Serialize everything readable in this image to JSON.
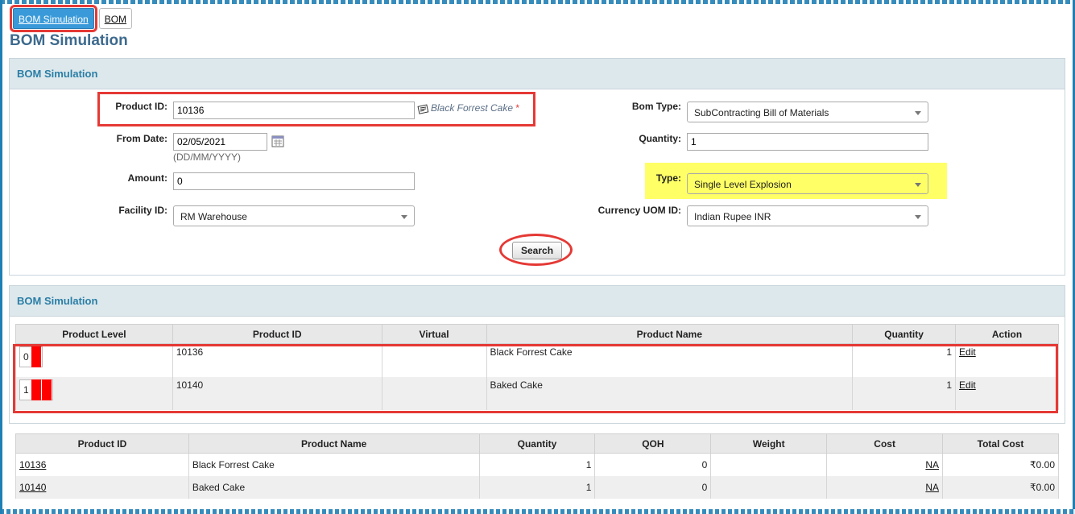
{
  "tabs": [
    {
      "label": "BOM Simulation",
      "active": true
    },
    {
      "label": "BOM",
      "active": false
    }
  ],
  "page_title": "BOM Simulation",
  "filter_panel": {
    "title": "BOM Simulation",
    "product_id": {
      "label": "Product ID:",
      "value": "10136",
      "product_name": "Black Forrest Cake",
      "required_mark": "*"
    },
    "from_date": {
      "label": "From Date:",
      "value": "02/05/2021",
      "format_hint": "(DD/MM/YYYY)"
    },
    "amount": {
      "label": "Amount:",
      "value": "0"
    },
    "facility_id": {
      "label": "Facility ID:",
      "value": "RM Warehouse"
    },
    "bom_type": {
      "label": "Bom Type:",
      "value": "SubContracting Bill of Materials"
    },
    "quantity": {
      "label": "Quantity:",
      "value": "1"
    },
    "type": {
      "label": "Type:",
      "value": "Single Level Explosion"
    },
    "currency_uom_id": {
      "label": "Currency UOM ID:",
      "value": "Indian Rupee INR"
    },
    "search_label": "Search"
  },
  "results_panel": {
    "title": "BOM Simulation",
    "columns": [
      "Product Level",
      "Product ID",
      "Virtual",
      "Product Name",
      "Quantity",
      "Action"
    ],
    "rows": [
      {
        "level": "0",
        "bars": 1,
        "product_id": "10136",
        "virtual": "",
        "product_name": "Black Forrest Cake",
        "quantity": "1",
        "action": "Edit"
      },
      {
        "level": "1",
        "bars": 2,
        "product_id": "10140",
        "virtual": "",
        "product_name": "Baked Cake",
        "quantity": "1",
        "action": "Edit"
      }
    ]
  },
  "cost_table": {
    "columns": [
      "Product ID",
      "Product Name",
      "Quantity",
      "QOH",
      "Weight",
      "Cost",
      "Total Cost"
    ],
    "rows": [
      {
        "product_id": "10136",
        "product_name": "Black Forrest Cake",
        "quantity": "1",
        "qoh": "0",
        "weight": "",
        "cost": "NA",
        "total_cost": "₹0.00"
      },
      {
        "product_id": "10140",
        "product_name": "Baked Cake",
        "quantity": "1",
        "qoh": "0",
        "weight": "",
        "cost": "NA",
        "total_cost": "₹0.00"
      }
    ]
  },
  "colors": {
    "accent": "#2a7ea6",
    "annotation_red": "#e53935",
    "annotation_yellow": "#ffff66",
    "level_bar": "#ff0000"
  },
  "icons": {
    "product_lookup": "lookup-icon",
    "calendar": "calendar-icon",
    "select_caret": "chevron-down-icon"
  }
}
